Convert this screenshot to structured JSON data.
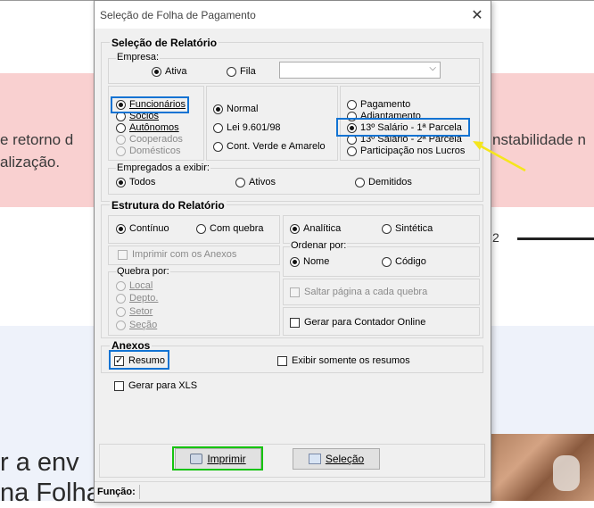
{
  "background": {
    "pink_line1_left": "e retorno d",
    "pink_line1_right": "nstabilidade n",
    "pink_line2": "alização.",
    "page_number": "2",
    "bottom_line1": "r a env",
    "bottom_line2": "na Folha"
  },
  "dialog": {
    "title": "Seleção de Folha de Pagamento",
    "close": "✕",
    "selecao": {
      "title": "Seleção de Relatório",
      "empresa_label": "Empresa:",
      "empresa_options": [
        {
          "label": "Ativa",
          "selected": true
        },
        {
          "label": "Fila",
          "selected": false
        }
      ],
      "empresa_select_value": "",
      "tipo_options": [
        {
          "label": "Funcionários",
          "selected": true,
          "enabled": true
        },
        {
          "label": "Sócios",
          "selected": false,
          "enabled": true
        },
        {
          "label": "Autônomos",
          "selected": false,
          "enabled": true
        },
        {
          "label": "Cooperados",
          "selected": false,
          "enabled": false
        },
        {
          "label": "Domésticos",
          "selected": false,
          "enabled": false
        }
      ],
      "regime_options": [
        {
          "label": "Normal",
          "selected": true
        },
        {
          "label": "Lei 9.601/98",
          "selected": false
        },
        {
          "label": "Cont. Verde e Amarelo",
          "selected": false
        }
      ],
      "folha_options": [
        {
          "label": "Pagamento",
          "selected": false
        },
        {
          "label": "Adiantamento",
          "selected": false
        },
        {
          "label": "13º Salário  -  1ª Parcela",
          "selected": true
        },
        {
          "label": "13º Salário  -  2ª Parcela",
          "selected": false
        },
        {
          "label": "Participação nos Lucros",
          "selected": false
        }
      ],
      "empregados_label": "Empregados a exibir:",
      "empregados_options": [
        {
          "label": "Todos",
          "selected": true
        },
        {
          "label": "Ativos",
          "selected": false
        },
        {
          "label": "Demitidos",
          "selected": false
        }
      ]
    },
    "estrutura": {
      "title": "Estrutura do Relatório",
      "continuo": "Contínuo",
      "com_quebra": "Com quebra",
      "imprimir_anexos": "Imprimir com os Anexos",
      "quebra_label": "Quebra por:",
      "quebra_options": [
        "Local",
        "Depto.",
        "Setor",
        "Seção"
      ],
      "analitica": "Analítica",
      "sintetica": "Sintética",
      "ordenar_label": "Ordenar por:",
      "nome": "Nome",
      "codigo": "Código",
      "saltar_pagina": "Saltar página a cada quebra",
      "gerar_contador": "Gerar para Contador Online"
    },
    "anexos": {
      "title": "Anexos",
      "resumo": "Resumo",
      "exibir_resumos": "Exibir somente os resumos",
      "gerar_xls": "Gerar para XLS"
    },
    "buttons": {
      "imprimir": "Imprimir",
      "selecao": "Seleção"
    },
    "status": {
      "funcao_label": "Função:"
    }
  },
  "colors": {
    "highlight_blue": "#1273d3",
    "highlight_green": "#16c30f",
    "annotation_arrow": "#f5e61c",
    "page_pink": "#f9d0d0"
  }
}
